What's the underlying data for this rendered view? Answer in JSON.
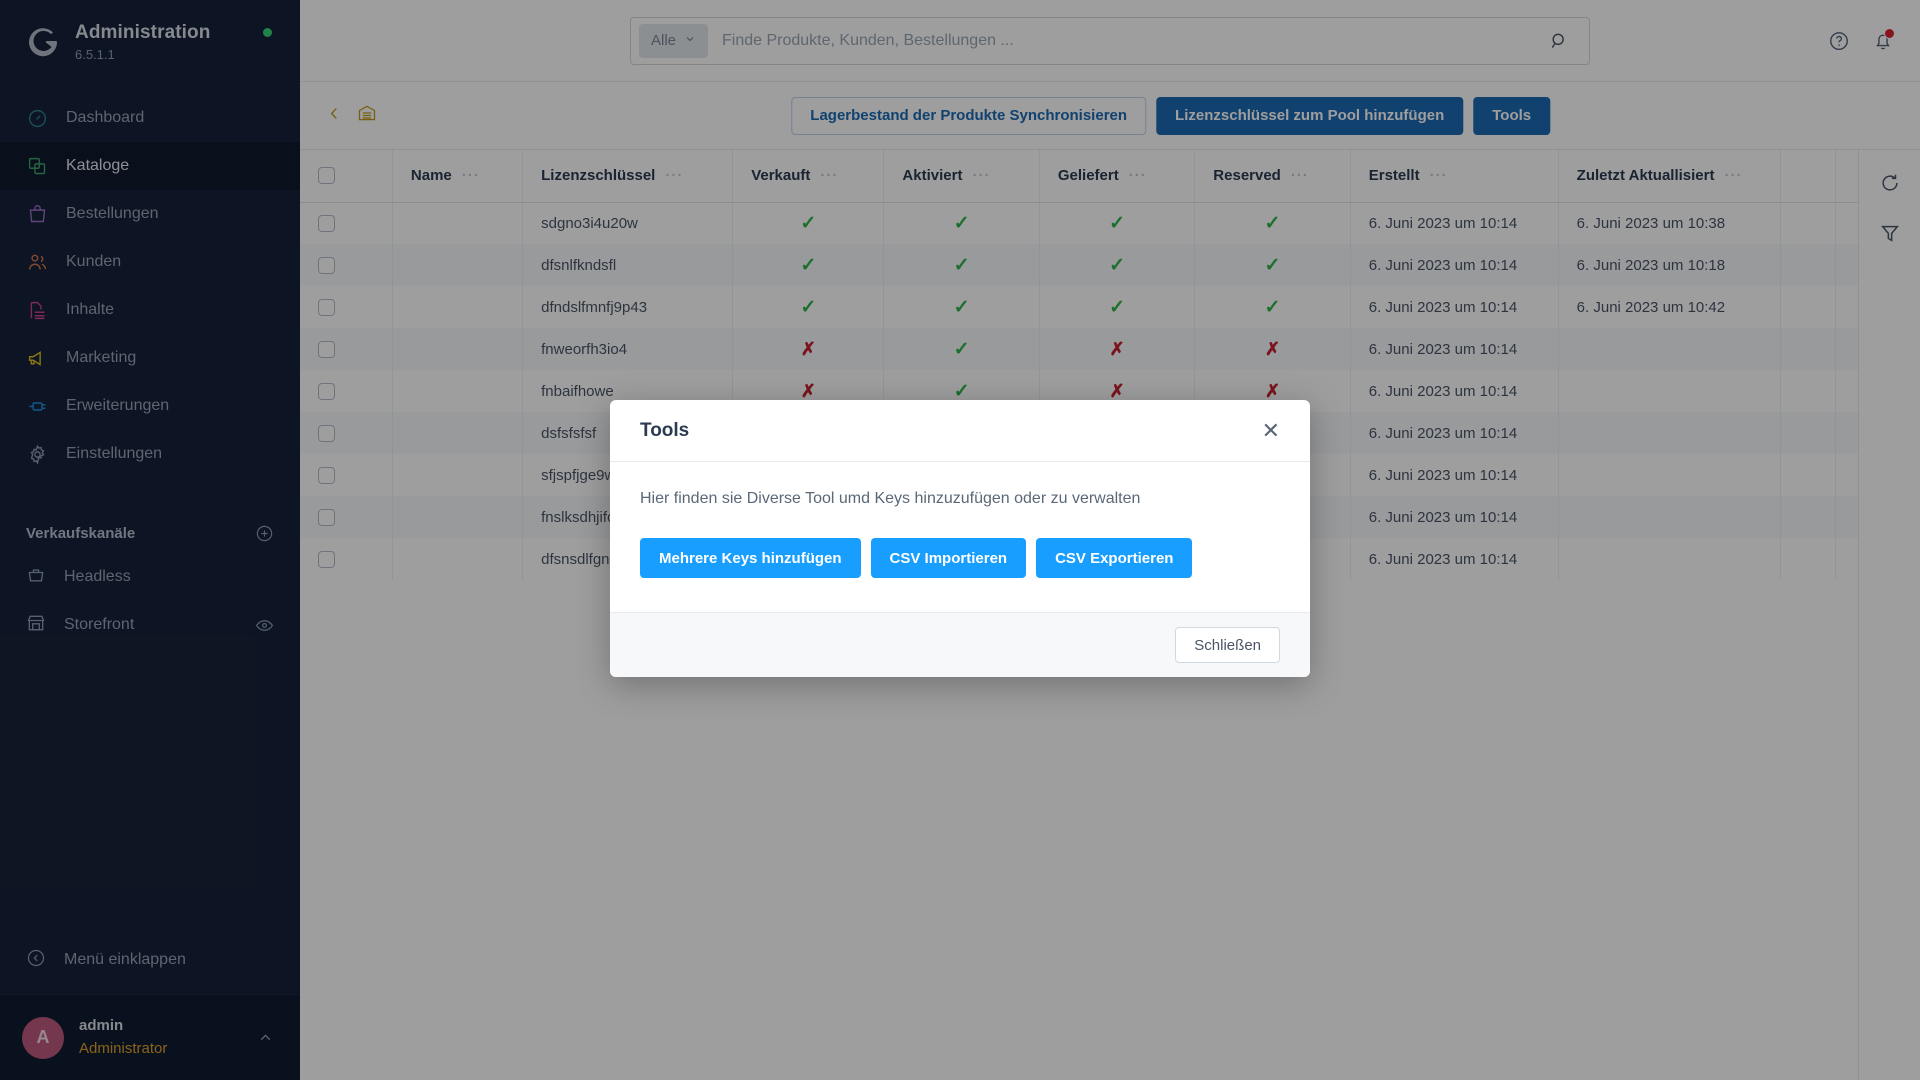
{
  "sidebar": {
    "brand": {
      "title": "Administration",
      "version": "6.5.1.1",
      "status_color": "#37d279"
    },
    "items": [
      {
        "label": "Dashboard",
        "icon": "dashboard-icon",
        "color": "#2f7f8f",
        "active": false
      },
      {
        "label": "Kataloge",
        "icon": "catalog-icon",
        "color": "#3aa36b",
        "active": true
      },
      {
        "label": "Bestellungen",
        "icon": "orders-icon",
        "color": "#9a6ec4",
        "active": false
      },
      {
        "label": "Kunden",
        "icon": "customers-icon",
        "color": "#d4764a",
        "active": false
      },
      {
        "label": "Inhalte",
        "icon": "content-icon",
        "color": "#cf3f94",
        "active": false
      },
      {
        "label": "Marketing",
        "icon": "marketing-icon",
        "color": "#e0c119",
        "active": false
      },
      {
        "label": "Erweiterungen",
        "icon": "extensions-icon",
        "color": "#1e8fe0",
        "active": false
      },
      {
        "label": "Einstellungen",
        "icon": "settings-icon",
        "color": "#8e9bb0",
        "active": false
      }
    ],
    "section_title": "Verkaufskanäle",
    "channels": [
      {
        "label": "Headless",
        "icon": "basket-icon",
        "has_eye": false
      },
      {
        "label": "Storefront",
        "icon": "storefront-icon",
        "has_eye": true
      }
    ],
    "collapse_label": "Menü einklappen",
    "user": {
      "initial": "A",
      "name": "admin",
      "role": "Administrator"
    }
  },
  "topbar": {
    "scope_label": "Alle",
    "search_placeholder": "Finde Produkte, Kunden, Bestellungen ...",
    "search_value": "",
    "help_icon": "help-icon",
    "notification_icon": "bell-icon",
    "notification_badge_color": "#d8232f"
  },
  "smartbar": {
    "back_icon": "chevron-left-icon",
    "module_icon": "warehouse-icon",
    "buttons": [
      {
        "label": "Lagerbestand der Produkte Synchronisieren",
        "style": "ghost"
      },
      {
        "label": "Lizenzschlüssel zum Pool hinzufügen",
        "style": "primary"
      },
      {
        "label": "Tools",
        "style": "primary"
      }
    ]
  },
  "table": {
    "columns": [
      "Name",
      "Lizenzschlüssel",
      "Verkauft",
      "Aktiviert",
      "Geliefert",
      "Reserved",
      "Erstellt",
      "Zuletzt Aktuallisiert"
    ],
    "header_menu_icon": "column-settings-icon",
    "rows": [
      {
        "name": "",
        "key": "sdgno3i4u20w",
        "verkauft": true,
        "aktiviert": true,
        "geliefert": true,
        "reserved": true,
        "erstellt": "6. Juni 2023 um 10:14",
        "aktualisiert": "6. Juni 2023 um 10:38"
      },
      {
        "name": "",
        "key": "dfsnlfkndsfl",
        "verkauft": true,
        "aktiviert": true,
        "geliefert": true,
        "reserved": true,
        "erstellt": "6. Juni 2023 um 10:14",
        "aktualisiert": "6. Juni 2023 um 10:18"
      },
      {
        "name": "",
        "key": "dfndslfmnfj9p43",
        "verkauft": true,
        "aktiviert": true,
        "geliefert": true,
        "reserved": true,
        "erstellt": "6. Juni 2023 um 10:14",
        "aktualisiert": "6. Juni 2023 um 10:42"
      },
      {
        "name": "",
        "key": "fnweorfh3io4",
        "verkauft": false,
        "aktiviert": true,
        "geliefert": false,
        "reserved": false,
        "erstellt": "6. Juni 2023 um 10:14",
        "aktualisiert": ""
      },
      {
        "name": "",
        "key": "fnbaifhowe",
        "verkauft": false,
        "aktiviert": true,
        "geliefert": false,
        "reserved": false,
        "erstellt": "6. Juni 2023 um 10:14",
        "aktualisiert": ""
      },
      {
        "name": "",
        "key": "dsfsfsfsf",
        "verkauft": false,
        "aktiviert": true,
        "geliefert": false,
        "reserved": false,
        "erstellt": "6. Juni 2023 um 10:14",
        "aktualisiert": ""
      },
      {
        "name": "",
        "key": "sfjspfjge9w",
        "verkauft": false,
        "aktiviert": true,
        "geliefert": false,
        "reserved": false,
        "erstellt": "6. Juni 2023 um 10:14",
        "aktualisiert": ""
      },
      {
        "name": "",
        "key": "fnslksdhjifo",
        "verkauft": false,
        "aktiviert": true,
        "geliefert": false,
        "reserved": false,
        "erstellt": "6. Juni 2023 um 10:14",
        "aktualisiert": ""
      },
      {
        "name": "",
        "key": "dfsnsdlfgno",
        "verkauft": false,
        "aktiviert": true,
        "geliefert": false,
        "reserved": false,
        "erstellt": "6. Juni 2023 um 10:14",
        "aktualisiert": ""
      }
    ],
    "row_action_label": "···",
    "side_tools": [
      {
        "icon": "refresh-icon"
      },
      {
        "icon": "filter-icon"
      }
    ]
  },
  "modal": {
    "title": "Tools",
    "close_icon": "close-icon",
    "description": "Hier finden sie Diverse Tool umd Keys hinzuzufügen oder zu verwalten",
    "actions": [
      {
        "label": "Mehrere Keys hinzufügen"
      },
      {
        "label": "CSV Importieren"
      },
      {
        "label": "CSV Exportieren"
      }
    ],
    "footer_button": "Schließen",
    "accent_color": "#189eff"
  }
}
